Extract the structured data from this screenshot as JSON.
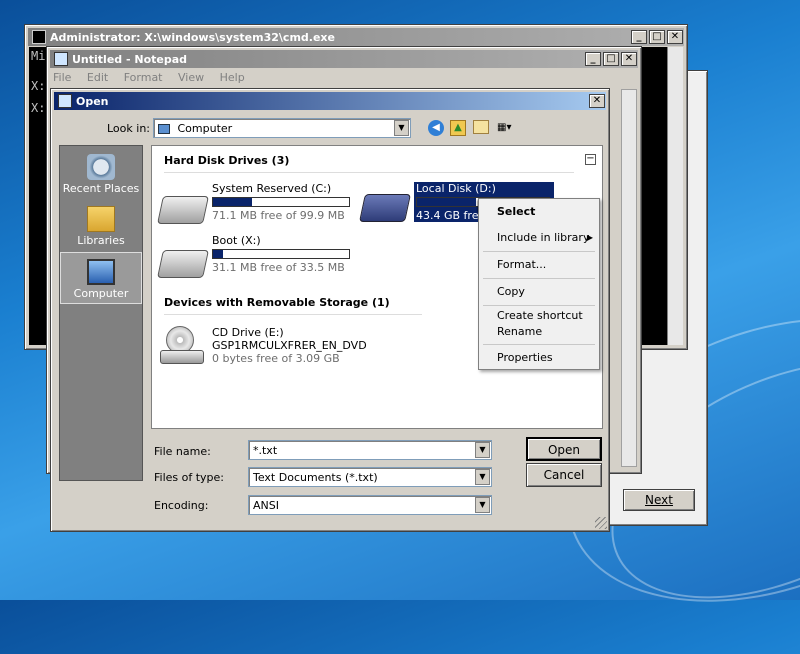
{
  "cmd_window": {
    "title": "Administrator: X:\\windows\\system32\\cmd.exe",
    "lines": [
      "Mi",
      "X:",
      "X:"
    ]
  },
  "notepad": {
    "title": "Untitled - Notepad",
    "menu": [
      "File",
      "Edit",
      "Format",
      "View",
      "Help"
    ]
  },
  "setup_window": {
    "next_label": "Next"
  },
  "open_dialog": {
    "title": "Open",
    "look_in_label": "Look in:",
    "look_in_value": "Computer",
    "places": [
      "Recent Places",
      "Libraries",
      "Computer"
    ],
    "section_hdd": "Hard Disk Drives (3)",
    "section_removable": "Devices with Removable Storage (1)",
    "drives": [
      {
        "name": "System Reserved (C:)",
        "free": "71.1 MB free of 99.9 MB",
        "used_fraction": 0.29
      },
      {
        "name": "Local Disk (D:)",
        "free": "43.4 GB free",
        "used_fraction": 0.45
      },
      {
        "name": "Boot (X:)",
        "free": "31.1 MB free of 33.5 MB",
        "used_fraction": 0.07
      }
    ],
    "cd": {
      "name": "CD Drive (E:)",
      "label": "GSP1RMCULXFRER_EN_DVD",
      "free": "0 bytes free of 3.09 GB"
    },
    "file_name_label": "File name:",
    "file_name_value": "*.txt",
    "file_type_label": "Files of type:",
    "file_type_value": "Text Documents (*.txt)",
    "encoding_label": "Encoding:",
    "encoding_value": "ANSI",
    "open_label": "Open",
    "cancel_label": "Cancel"
  },
  "context_menu": [
    "Select",
    "Include in library",
    "Format...",
    "Copy",
    "Create shortcut",
    "Rename",
    "Properties"
  ]
}
